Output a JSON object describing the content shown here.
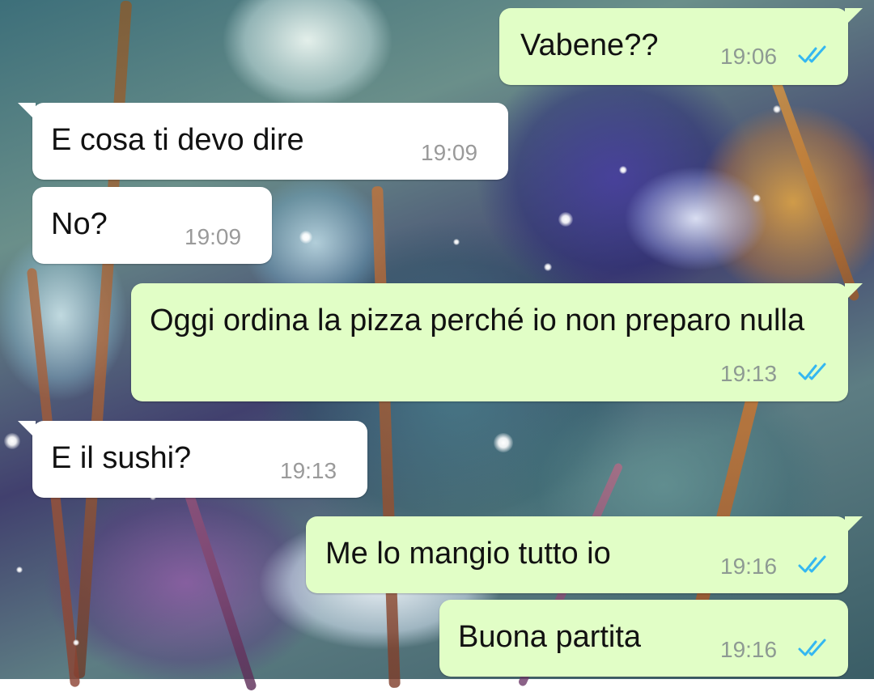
{
  "chat": {
    "messages": [
      {
        "direction": "outgoing",
        "text": "Vabene??",
        "time": "19:06",
        "status": "read-double-tick"
      },
      {
        "direction": "incoming",
        "text": "E cosa ti devo dire",
        "time": "19:09"
      },
      {
        "direction": "incoming",
        "text": "No?",
        "time": "19:09"
      },
      {
        "direction": "outgoing",
        "text": "Oggi ordina la pizza perché io non preparo nulla",
        "time": "19:13",
        "status": "read-double-tick"
      },
      {
        "direction": "incoming",
        "text": "E il sushi?",
        "time": "19:13"
      },
      {
        "direction": "outgoing",
        "text": "Me lo mangio tutto io",
        "time": "19:16",
        "status": "read-double-tick"
      },
      {
        "direction": "outgoing",
        "text": "Buona partita",
        "time": "19:16",
        "status": "read-double-tick"
      }
    ]
  },
  "colors": {
    "incoming_bubble": "#ffffff",
    "outgoing_bubble": "#e1fec6",
    "read_tick": "#34b7f1",
    "timestamp": "#8e9a93"
  },
  "icons": {
    "read_receipt": "double-check-icon"
  }
}
